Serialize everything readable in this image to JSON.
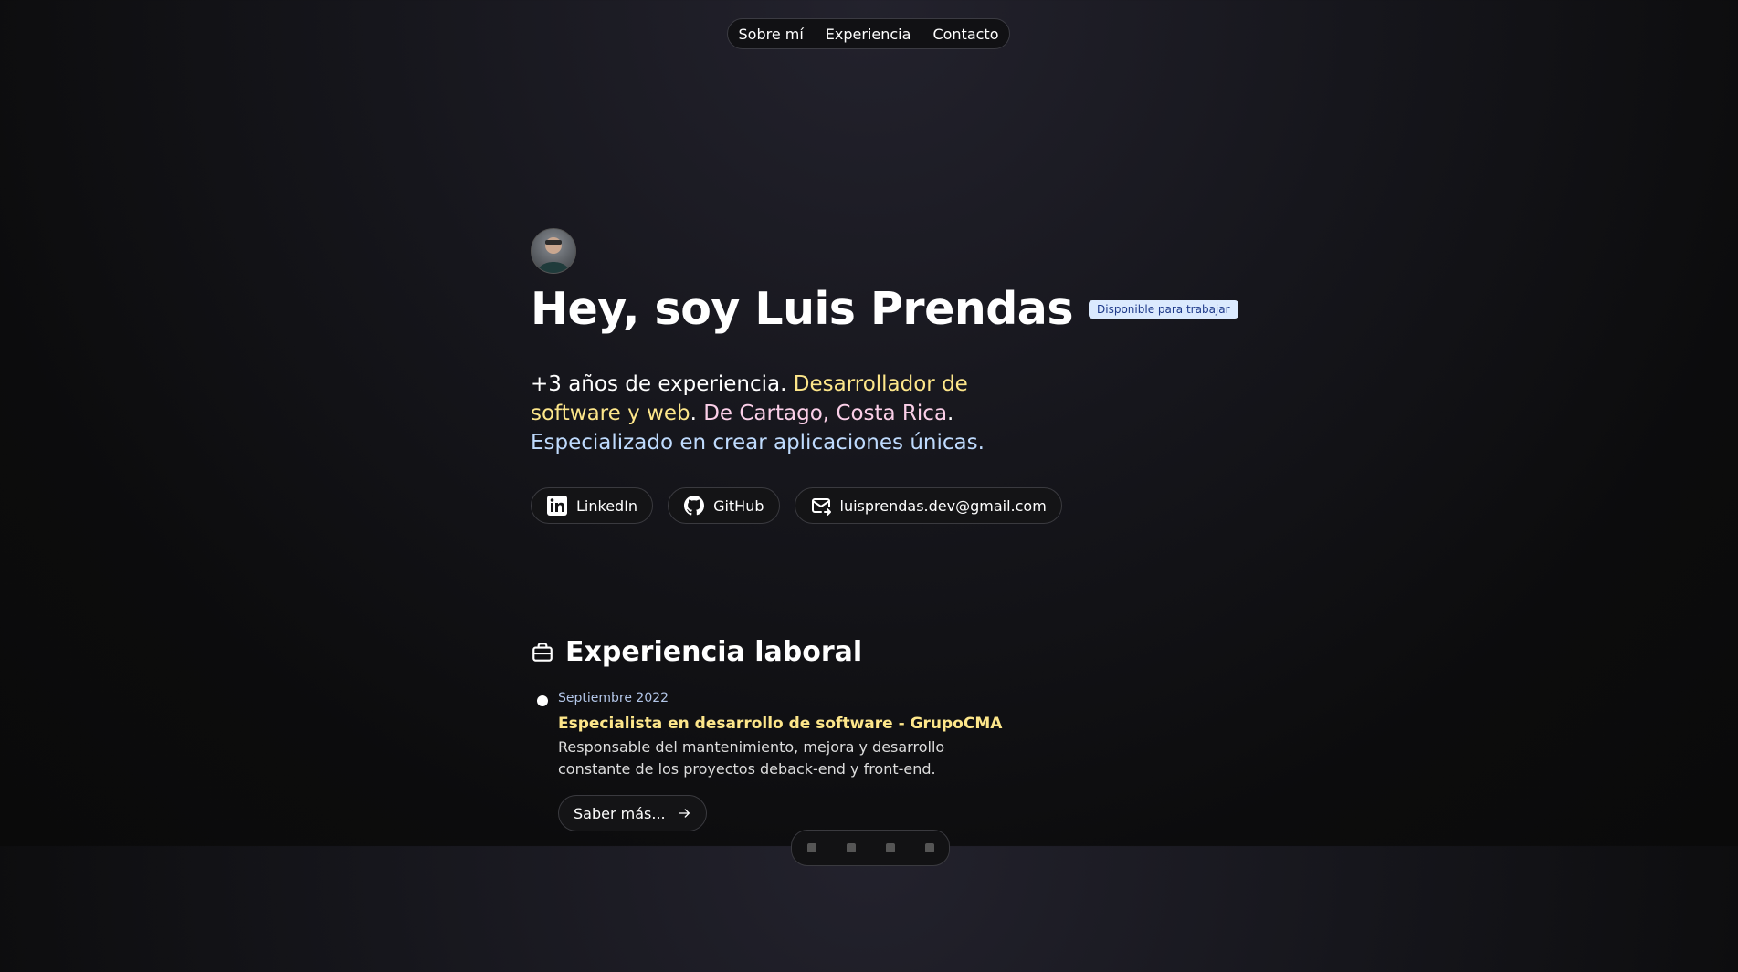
{
  "nav": {
    "items": [
      "Sobre mí",
      "Experiencia",
      "Contacto"
    ]
  },
  "hero": {
    "title": "Hey, soy Luis Prendas",
    "badge": "Disponible para trabajar",
    "intro": {
      "p1": "+3 años de experiencia.",
      "p2": "Desarrollador de software y web",
      "p3": ".",
      "p4": "De Cartago, Costa Rica",
      "p5": ".",
      "p6": "Especializado en crear aplicaciones únicas."
    }
  },
  "links": [
    {
      "icon": "linkedin-icon",
      "label": "LinkedIn"
    },
    {
      "icon": "github-icon",
      "label": "GitHub"
    },
    {
      "icon": "mail-icon",
      "label": "luisprendas.dev@gmail.com"
    }
  ],
  "experience": {
    "title": "Experiencia laboral",
    "items": [
      {
        "date": "Septiembre 2022",
        "role": "Especialista en desarrollo de software - GrupoCMA",
        "description": "Responsable del mantenimiento, mejora y desarrollo constante de los proyectos deback-end y front-end.",
        "button": "Saber más..."
      }
    ]
  }
}
